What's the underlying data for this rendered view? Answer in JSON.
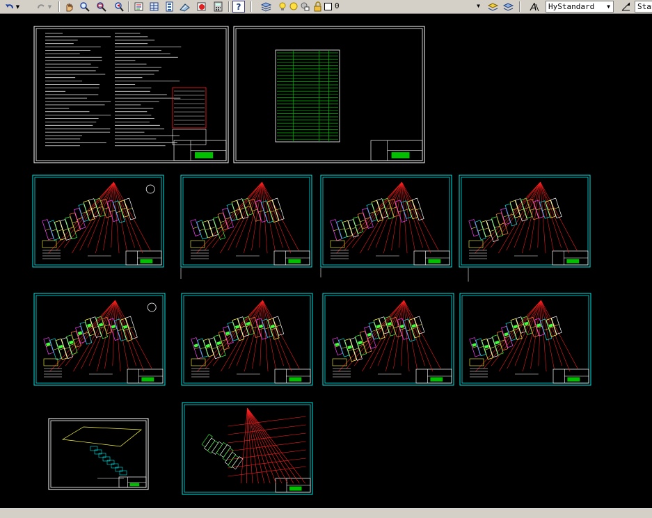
{
  "toolbar": {
    "layer_value": "0",
    "text_style_value": "HyStandard",
    "dim_style_value": "Stan",
    "help_label": "?"
  },
  "colors": {
    "background": "#000000",
    "sheet_border": "#00e5e5",
    "white_border": "#ffffff",
    "red_line": "#ff2020",
    "green_table": "#00c000",
    "toolbar_bg": "#d4d0c8"
  },
  "drawings": {
    "count": 12,
    "types": [
      "notes-sheet",
      "schedule-sheet",
      "floor-plan",
      "floor-plan",
      "floor-plan",
      "floor-plan",
      "floor-plan",
      "floor-plan",
      "floor-plan",
      "floor-plan",
      "site-plan",
      "site-plan"
    ]
  }
}
